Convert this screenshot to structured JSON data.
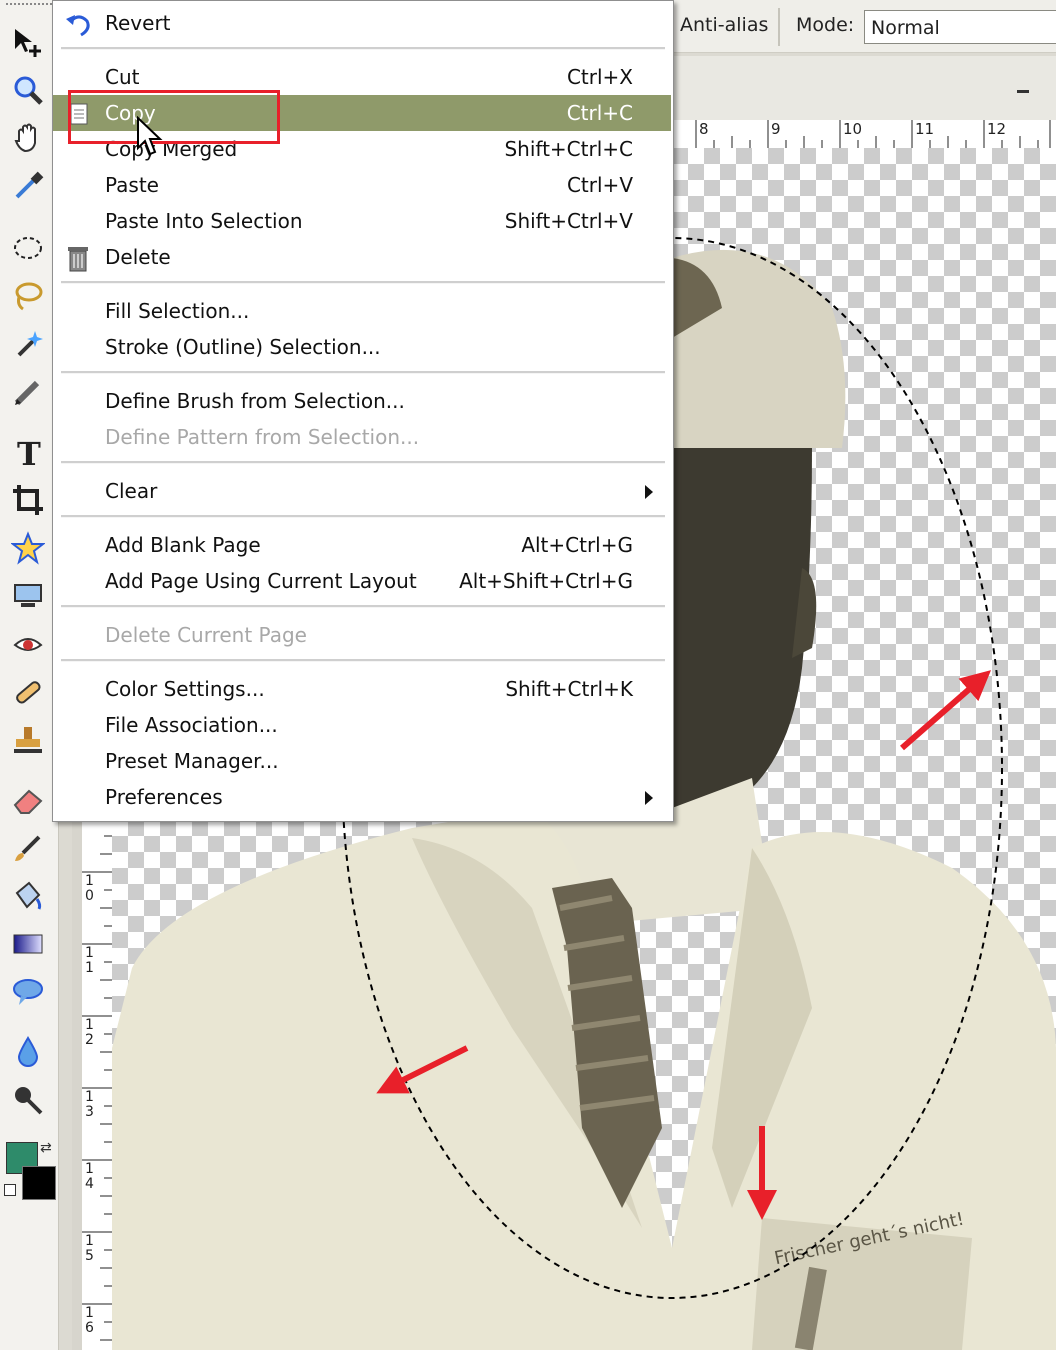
{
  "options_bar": {
    "antialias_label": "Anti-alias",
    "mode_label": "Mode:",
    "mode_value": "Normal"
  },
  "ruler": {
    "horizontal": [
      "8",
      "9",
      "10",
      "11",
      "12"
    ],
    "vertical": [
      "1 0",
      "1 1",
      "1 2",
      "1 3",
      "1 4",
      "1 5",
      "1 6"
    ]
  },
  "menu": {
    "items": [
      {
        "label": "Revert",
        "shortcut": ""
      },
      {
        "label": "Cut",
        "shortcut": "Ctrl+X"
      },
      {
        "label": "Copy",
        "shortcut": "Ctrl+C",
        "highlighted": true
      },
      {
        "label": "Copy Merged",
        "shortcut": "Shift+Ctrl+C"
      },
      {
        "label": "Paste",
        "shortcut": "Ctrl+V"
      },
      {
        "label": "Paste Into Selection",
        "shortcut": "Shift+Ctrl+V"
      },
      {
        "label": "Delete",
        "shortcut": ""
      },
      {
        "label": "Fill Selection...",
        "shortcut": ""
      },
      {
        "label": "Stroke (Outline) Selection...",
        "shortcut": ""
      },
      {
        "label": "Define Brush from Selection...",
        "shortcut": ""
      },
      {
        "label": "Define Pattern from Selection...",
        "shortcut": "",
        "disabled": true
      },
      {
        "label": "Clear",
        "shortcut": "",
        "submenu": true
      },
      {
        "label": "Add Blank Page",
        "shortcut": "Alt+Ctrl+G"
      },
      {
        "label": "Add Page Using Current Layout",
        "shortcut": "Alt+Shift+Ctrl+G"
      },
      {
        "label": "Delete Current Page",
        "shortcut": "",
        "disabled": true
      },
      {
        "label": "Color Settings...",
        "shortcut": "Shift+Ctrl+K"
      },
      {
        "label": "File Association...",
        "shortcut": ""
      },
      {
        "label": "Preset Manager...",
        "shortcut": ""
      },
      {
        "label": "Preferences",
        "shortcut": "",
        "submenu": true
      }
    ]
  },
  "canvas": {
    "pocket_text": "Frischer geht´s nicht!"
  },
  "colors": {
    "highlight": "#8f9a6a",
    "annotation_red": "#e8202a",
    "foreground_swatch": "#2e8b6a",
    "background_swatch": "#000000"
  },
  "tools": [
    "move-icon",
    "zoom-icon",
    "hand-icon",
    "eyedropper-icon",
    "marquee-icon",
    "lasso-icon",
    "magic-wand-icon",
    "pencil-icon",
    "type-icon",
    "crop-icon",
    "custom-shape-icon",
    "screen-icon",
    "red-eye-icon",
    "healing-icon",
    "stamp-icon",
    "eraser-icon",
    "brush-icon",
    "paint-bucket-icon",
    "gradient-icon",
    "speech-bubble-icon",
    "blur-drop-icon",
    "sponge-icon"
  ]
}
